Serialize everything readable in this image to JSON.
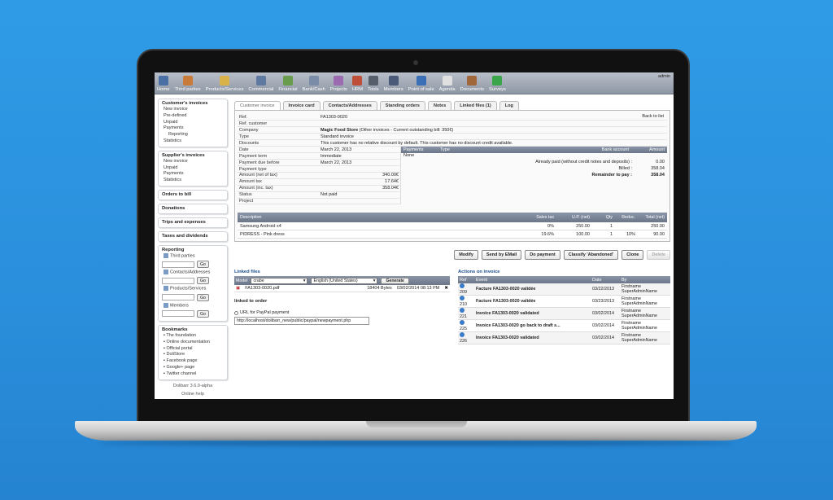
{
  "topbar": {
    "menu": [
      {
        "label": "Home",
        "icon": "home-icon",
        "color": "#4a6fa5"
      },
      {
        "label": "Third parties",
        "icon": "third-parties-icon",
        "color": "#c97b3a"
      },
      {
        "label": "Products/Services",
        "icon": "products-icon",
        "color": "#d9b34a"
      },
      {
        "label": "Commercial",
        "icon": "commercial-icon",
        "color": "#5f7aa0"
      },
      {
        "label": "Financial",
        "icon": "financial-icon",
        "color": "#6a9c4e"
      },
      {
        "label": "Bank/Cash",
        "icon": "bank-icon",
        "color": "#7a8ca8"
      },
      {
        "label": "Projects",
        "icon": "projects-icon",
        "color": "#9c6ab0"
      },
      {
        "label": "HRM",
        "icon": "hrm-icon",
        "color": "#c04f3a"
      },
      {
        "label": "Tools",
        "icon": "tools-icon",
        "color": "#555e6a"
      },
      {
        "label": "Members",
        "icon": "members-icon",
        "color": "#4a5a78"
      },
      {
        "label": "Point of sale",
        "icon": "pos-icon",
        "color": "#3a6fb5"
      },
      {
        "label": "Agenda",
        "icon": "agenda-icon",
        "color": "#e0e0e0"
      },
      {
        "label": "Documents",
        "icon": "documents-icon",
        "color": "#a0673a"
      },
      {
        "label": "Surveys",
        "icon": "surveys-icon",
        "color": "#3aa54a"
      }
    ],
    "admin": "admin"
  },
  "sidebar": {
    "customer_invoices": {
      "title": "Customer's invoices",
      "items": [
        "New invoice",
        "Pre-defined",
        "Unpaid",
        "Payments"
      ],
      "sub": "Reporting",
      "last": "Statistics"
    },
    "supplier_invoices": {
      "title": "Supplier's invoices",
      "items": [
        "New invoice",
        "Unpaid",
        "Payments",
        "Statistics"
      ]
    },
    "orders_to_bill": "Orders to bill",
    "donations": "Donations",
    "trips": "Trips and expenses",
    "taxes": "Taxes and dividends",
    "reporting": {
      "title": "Reporting",
      "searches": [
        "Third parties",
        "Contacts/Addresses",
        "Products/Services",
        "Members"
      ],
      "go": "Go"
    },
    "bookmarks": {
      "title": "Bookmarks",
      "items": [
        "The foundation",
        "Online documentation",
        "Official portal",
        "DoliStore",
        "Facebook page",
        "Google+ page",
        "Twitter channel"
      ]
    },
    "version": "Dolibarr 3.6.0-alpha",
    "help": "Online help"
  },
  "tabs": [
    "Customer invoice",
    "Invoice card",
    "Contacts/Addresses",
    "Standing orders",
    "Notes",
    "Linked files (1)",
    "Log"
  ],
  "invoice": {
    "back_to_list": "Back to list",
    "fields": [
      {
        "k": "Ref.",
        "v": "FA1303-0020"
      },
      {
        "k": "Ref. customer",
        "v": ""
      },
      {
        "k": "Company",
        "v": "Magic Food Store"
      },
      {
        "k": "Type",
        "v": "Standard invoice"
      },
      {
        "k": "Discounts",
        "v": "This customer has no relative discount by default. This customer has no discount credit available."
      }
    ],
    "company_extra": "(Other invoices - Current outstanding bill: 350€)",
    "left_fields": [
      {
        "k": "Date",
        "v": "March 22, 2013"
      },
      {
        "k": "Payment term",
        "v": "Immediate"
      },
      {
        "k": "Payment due before",
        "v": "March 22, 2013"
      },
      {
        "k": "Payment type",
        "v": ""
      },
      {
        "k": "Amount (net of tax)",
        "v": "340.00€"
      },
      {
        "k": "Amount tax",
        "v": "17.64€"
      },
      {
        "k": "Amount (inc. tax)",
        "v": "358.04€"
      },
      {
        "k": "Status",
        "v": "Not paid"
      },
      {
        "k": "Project",
        "v": ""
      }
    ],
    "payments": {
      "headers": [
        "Payments",
        "Type",
        "Bank account",
        "Amount"
      ],
      "none": "None",
      "rows": [
        {
          "label": "Already paid (without credit notes and deposits) :",
          "v": "0.00"
        },
        {
          "label": "Billed :",
          "v": "358.04"
        },
        {
          "label": "Remainder to pay :",
          "v": "358.04"
        }
      ]
    },
    "lines": {
      "headers": [
        "Description",
        "Sales tax",
        "U.P. (net)",
        "Qty",
        "Reduc.",
        "Total (net)"
      ],
      "rows": [
        {
          "desc": "Samsung Android x4",
          "tax": "0%",
          "up": "250.00",
          "qty": "1",
          "red": "",
          "tot": "250.00"
        },
        {
          "desc": "PIDRESS - Pink dress",
          "tax": "19.6%",
          "up": "100.00",
          "qty": "1",
          "red": "10%",
          "tot": "90.00"
        }
      ]
    }
  },
  "actions": [
    "Modify",
    "Send by EMail",
    "Do payment",
    "Classify 'Abandoned'",
    "Clone",
    "Delete"
  ],
  "linked_files": {
    "title": "Linked files",
    "model_label": "Model",
    "model": "crabe",
    "lang": "English (United States)",
    "generate": "Generate",
    "file": {
      "name": "FA1303-0020.pdf",
      "size": "18404 Bytes",
      "date": "03/02/2014 08:13 PM"
    },
    "linked_to_order": "linked to order",
    "paypal_label": "URL for PayPal payment",
    "paypal_url": "http://localhost/dolibarr_new/public/paypal/newpayment.php"
  },
  "events": {
    "title": "Actions on invoice",
    "headers": [
      "Ref",
      "Event",
      "Date",
      "By"
    ],
    "rows": [
      {
        "ref": "209",
        "ev": "Facture FA1303-0020 validée",
        "date": "03/22/2013",
        "by": "Firstname SuperAdminName"
      },
      {
        "ref": "210",
        "ev": "Facture FA1303-0020 validée",
        "date": "03/23/2013",
        "by": "Firstname SuperAdminName"
      },
      {
        "ref": "221",
        "ev": "Invoice FA1303-0020 validated",
        "date": "03/02/2014",
        "by": "Firstname SuperAdminName"
      },
      {
        "ref": "225",
        "ev": "Invoice FA1303-0020 go back to draft s...",
        "date": "03/02/2014",
        "by": "Firstname SuperAdminName"
      },
      {
        "ref": "226",
        "ev": "Invoice FA1303-0020 validated",
        "date": "03/02/2014",
        "by": "Firstname SuperAdminName"
      }
    ]
  }
}
